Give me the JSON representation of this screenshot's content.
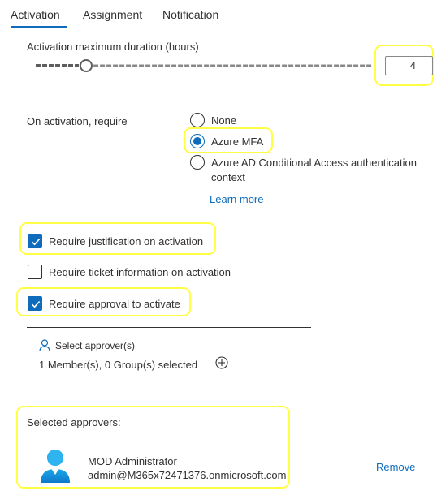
{
  "tabs": [
    {
      "label": "Activation",
      "active": true
    },
    {
      "label": "Assignment",
      "active": false
    },
    {
      "label": "Notification",
      "active": false
    }
  ],
  "duration": {
    "label": "Activation maximum duration (hours)",
    "value": "4",
    "slider_fraction": 0.15
  },
  "activation_require": {
    "label": "On activation, require",
    "options": [
      {
        "label": "None",
        "selected": false
      },
      {
        "label": "Azure MFA",
        "selected": true
      },
      {
        "label_line1": "Azure AD Conditional Access authentication",
        "label_line2": "context",
        "selected": false
      }
    ],
    "learn_more": "Learn more"
  },
  "checkboxes": {
    "justification": {
      "label": "Require justification on activation",
      "checked": true
    },
    "ticket": {
      "label": "Require ticket information on activation",
      "checked": false
    },
    "approval": {
      "label": "Require approval to activate",
      "checked": true
    }
  },
  "approver_picker": {
    "label": "Select approver(s)",
    "summary": "1 Member(s), 0 Group(s) selected"
  },
  "selected_approvers": {
    "title": "Selected approvers:",
    "items": [
      {
        "name": "MOD Administrator",
        "email": "admin@M365x72471376.onmicrosoft.com",
        "remove_label": "Remove"
      }
    ]
  },
  "colors": {
    "accent": "#0f6cbd",
    "highlight": "#ffff46"
  }
}
